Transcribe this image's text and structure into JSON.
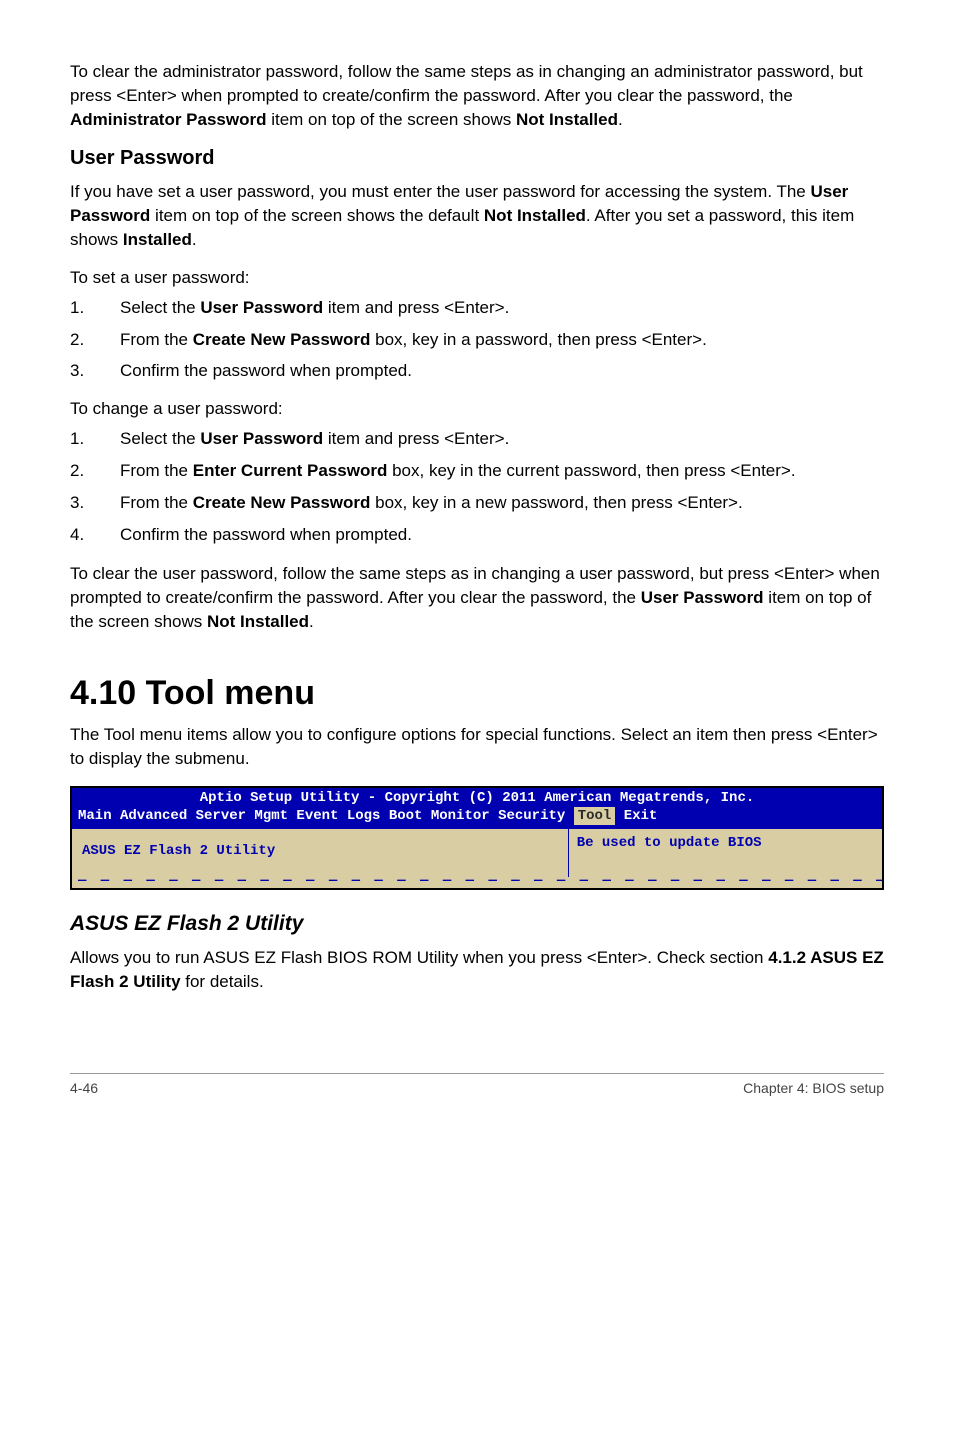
{
  "intro": {
    "p1": "To clear the administrator password, follow the same steps as in changing an administrator password, but press <Enter> when prompted to create/confirm the password. After you clear the password, the ",
    "p1_bold": "Administrator Password",
    "p1_cont": " item on top of the screen shows ",
    "p1_bold2": "Not Installed",
    "p1_end": "."
  },
  "user_password": {
    "heading": "User Password",
    "p1_a": "If you have set a user password, you must enter the user password for accessing the system. The ",
    "p1_b": "User Password",
    "p1_c": " item on top of the screen shows the default ",
    "p1_d": "Not Installed",
    "p1_e": ". After you set a password, this item shows ",
    "p1_f": "Installed",
    "p1_g": ".",
    "set_title": "To set a user password:",
    "set_steps": [
      {
        "num": "1.",
        "a": "Select the ",
        "b": "User Password",
        "c": " item and press <Enter>."
      },
      {
        "num": "2.",
        "a": "From the ",
        "b": "Create New Password",
        "c": " box, key in a password, then press <Enter>."
      },
      {
        "num": "3.",
        "a": "Confirm the password when prompted.",
        "b": "",
        "c": ""
      }
    ],
    "change_title": "To change a user password:",
    "change_steps": [
      {
        "num": "1.",
        "a": "Select the ",
        "b": "User Password",
        "c": " item and press <Enter>."
      },
      {
        "num": "2.",
        "a": "From the ",
        "b": "Enter Current Password",
        "c": " box, key in the current password, then press <Enter>."
      },
      {
        "num": "3.",
        "a": "From the ",
        "b": "Create New Password",
        "c": " box, key in a new password, then press <Enter>."
      },
      {
        "num": "4.",
        "a": "Confirm the password when prompted.",
        "b": "",
        "c": ""
      }
    ],
    "clear_a": "To clear the user password, follow the same steps as in changing a user password, but press <Enter> when prompted to create/confirm the password. After you clear the password, the ",
    "clear_b": "User Password",
    "clear_c": " item on top of the screen shows ",
    "clear_d": "Not Installed",
    "clear_e": "."
  },
  "tool_menu": {
    "heading": "4.10   Tool menu",
    "p1": "The Tool menu items allow you to configure options for special functions. Select an item then press <Enter> to display the submenu."
  },
  "bios": {
    "title": "Aptio Setup Utility - Copyright (C) 2011 American Megatrends, Inc.",
    "menu_prefix": " Main  Advanced  Server Mgmt  Event Logs  Boot  Monitor  Security ",
    "menu_active": "Tool",
    "menu_suffix": " Exit",
    "left_item": "ASUS EZ Flash 2 Utility",
    "right_help": "Be used to update BIOS",
    "dashes": "— — — — — — — — — — — — — — — — — — — — — — — — — — — — — — — — — — — — — — — —"
  },
  "ez_flash": {
    "heading": "ASUS EZ Flash 2 Utility",
    "p1_a": "Allows you to run ASUS EZ Flash BIOS ROM Utility when you press <Enter>. Check section ",
    "p1_b": "4.1.2 ASUS EZ Flash 2 Utility",
    "p1_c": " for details."
  },
  "footer": {
    "left": "4-46",
    "right": "Chapter 4: BIOS setup"
  }
}
